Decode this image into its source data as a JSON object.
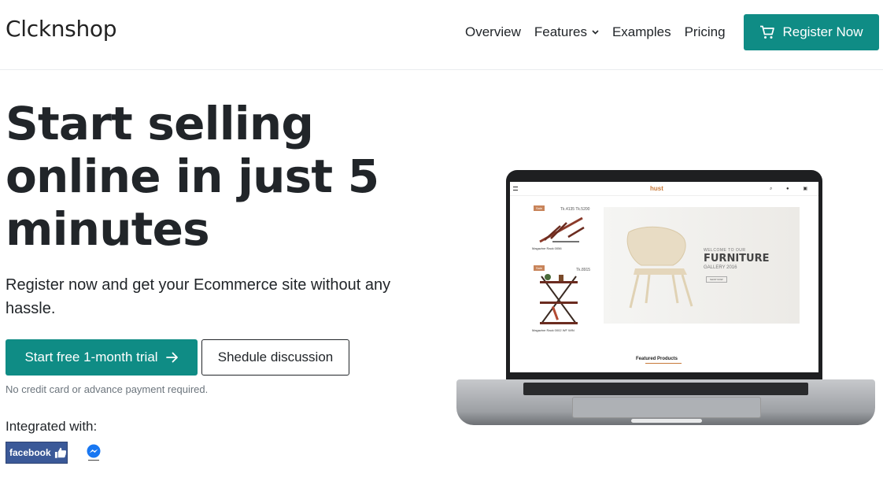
{
  "header": {
    "brand": "Clcknshop",
    "nav": {
      "overview": "Overview",
      "features": "Features",
      "examples": "Examples",
      "pricing": "Pricing"
    },
    "register_button": "Register Now"
  },
  "hero": {
    "title": "Start selling online in just 5 minutes",
    "subtitle": "Register now and get your Ecommerce site without any hassle.",
    "trial_button": "Start free 1-month trial",
    "discussion_button": "Shedule discussion",
    "note": "No credit card or advance payment required.",
    "integrated_label": "Integrated with:",
    "facebook_text": "facebook"
  },
  "mockup": {
    "logo": "hust",
    "sale_badge": "Sale",
    "price_1": "Tk.4135 Tk.5200",
    "product_1": "Magazine Rack 0056",
    "price_2": "Tk.8915",
    "product_2": "Magazine Rack 0002 WF WIN",
    "welcome": "WELCOME TO OUR",
    "headline": "FURNITURE",
    "gallery": "GALLERY 2016",
    "shop_now": "SHOP NOW",
    "featured": "Featured Products"
  },
  "colors": {
    "accent": "#0f8c85",
    "text": "#212529",
    "muted": "#6c757d",
    "facebook": "#3b5998"
  }
}
